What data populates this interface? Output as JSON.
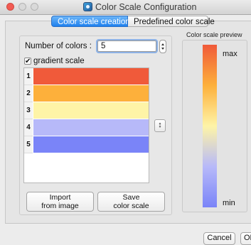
{
  "window": {
    "title": "Color Scale Configuration"
  },
  "tabs": [
    {
      "label": "Color scale creation"
    },
    {
      "label": "Predefined color scale"
    }
  ],
  "creation": {
    "num_colors_label": "Number of colors :",
    "num_colors_value": "5",
    "gradient_label": "gradient scale",
    "gradient_checked": true,
    "gradient_check_glyph": "✔",
    "rows": [
      {
        "index": "1",
        "color": "#f05a3a"
      },
      {
        "index": "2",
        "color": "#fdb03b"
      },
      {
        "index": "3",
        "color": "#fef4a7"
      },
      {
        "index": "4",
        "color": "#b7b9f9"
      },
      {
        "index": "5",
        "color": "#7a84f8"
      }
    ],
    "swap_icon": "↕",
    "import_label_1": "Import",
    "import_label_2": "from image",
    "save_label_1": "Save",
    "save_label_2": "color scale"
  },
  "preview": {
    "title": "Color scale preview",
    "max_label": "max",
    "min_label": "min"
  },
  "footer": {
    "cancel_label": "Cancel",
    "ok_label": "OK"
  }
}
